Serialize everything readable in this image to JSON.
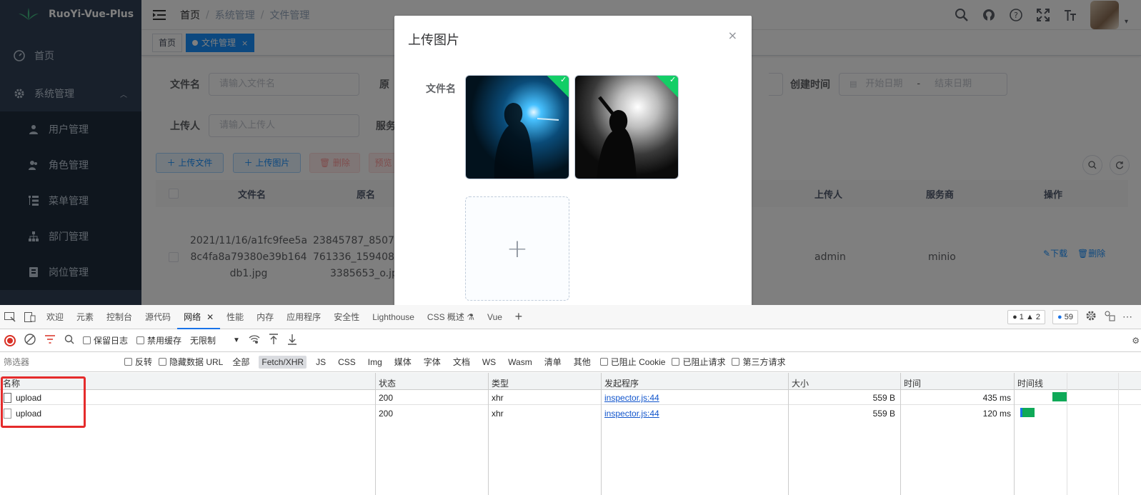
{
  "app": {
    "logo_text": "RuoYi-Vue-Plus",
    "sidebar": {
      "items": [
        {
          "label": "首页",
          "icon": "dashboard-icon"
        },
        {
          "label": "系统管理",
          "icon": "gear-icon"
        },
        {
          "label": "用户管理",
          "icon": "user-icon"
        },
        {
          "label": "角色管理",
          "icon": "peoples-icon"
        },
        {
          "label": "菜单管理",
          "icon": "tree-table-icon"
        },
        {
          "label": "部门管理",
          "icon": "tree-icon"
        },
        {
          "label": "岗位管理",
          "icon": "post-icon"
        }
      ]
    },
    "breadcrumb": [
      "首页",
      "系统管理",
      "文件管理"
    ],
    "tags": [
      {
        "label": "首页",
        "active": false
      },
      {
        "label": "文件管理",
        "active": true,
        "close": "×"
      }
    ],
    "search_form": {
      "file_name_label": "文件名",
      "file_name_placeholder": "请输入文件名",
      "original_name_label": "原",
      "uploader_label": "上传人",
      "uploader_placeholder": "请输入上传人",
      "service_label": "服务",
      "created_time_label": "创建时间",
      "start_date_placeholder": "开始日期",
      "date_sep": "-",
      "end_date_placeholder": "结束日期"
    },
    "toolbar": {
      "upload_file": "＋ 上传文件",
      "upload_image": "＋ 上传图片",
      "delete": "🗑 删除",
      "preview": "预览"
    },
    "table": {
      "headers": [
        "文件名",
        "原名",
        "上传人",
        "服务商",
        "操作"
      ],
      "row": {
        "file_name_lines": [
          "2021/11/16/a1fc9fee5a",
          "8c4fa8a79380e39b164",
          "db1.jpg"
        ],
        "original_lines": [
          "23845787_8507",
          "761336_159408",
          "3385653_o.jp"
        ],
        "uploader": "admin",
        "service": "minio",
        "download": "下载",
        "delete": "删除"
      }
    },
    "dialog": {
      "title": "上传图片",
      "close": "×",
      "field_label": "文件名",
      "plus": "+"
    }
  },
  "devtools": {
    "tabs": [
      "欢迎",
      "元素",
      "控制台",
      "源代码",
      "网络",
      "性能",
      "内存",
      "应用程序",
      "安全性",
      "Lighthouse",
      "CSS 概述 ⚗",
      "Vue"
    ],
    "active_tab": "网络",
    "badges": {
      "errors": "● 1",
      "warnings": "▲ 2",
      "messages": "59"
    },
    "toolbar": {
      "preserve_log": "保留日志",
      "disable_cache": "禁用缓存",
      "throttle": "无限制"
    },
    "filter": {
      "placeholder": "筛选器",
      "invert": "反转",
      "hide_data_url": "隐藏数据 URL",
      "types": [
        "全部",
        "Fetch/XHR",
        "JS",
        "CSS",
        "Img",
        "媒体",
        "字体",
        "文档",
        "WS",
        "Wasm",
        "清单",
        "其他"
      ],
      "active_type": "Fetch/XHR",
      "blocked_cookies": "已阻止 Cookie",
      "blocked_requests": "已阻止请求",
      "third_party": "第三方请求"
    },
    "columns": [
      "名称",
      "状态",
      "类型",
      "发起程序",
      "大小",
      "时间",
      "时间线"
    ],
    "rows": [
      {
        "name": "upload",
        "status": "200",
        "type": "xhr",
        "initiator": "inspector.js:44",
        "size": "559 B",
        "time": "435 ms"
      },
      {
        "name": "upload",
        "status": "200",
        "type": "xhr",
        "initiator": "inspector.js:44",
        "size": "559 B",
        "time": "120 ms"
      }
    ],
    "colors": {
      "accent": "#1a73e8",
      "highlight_box": "#e52b2b",
      "success": "#13ce66"
    }
  }
}
